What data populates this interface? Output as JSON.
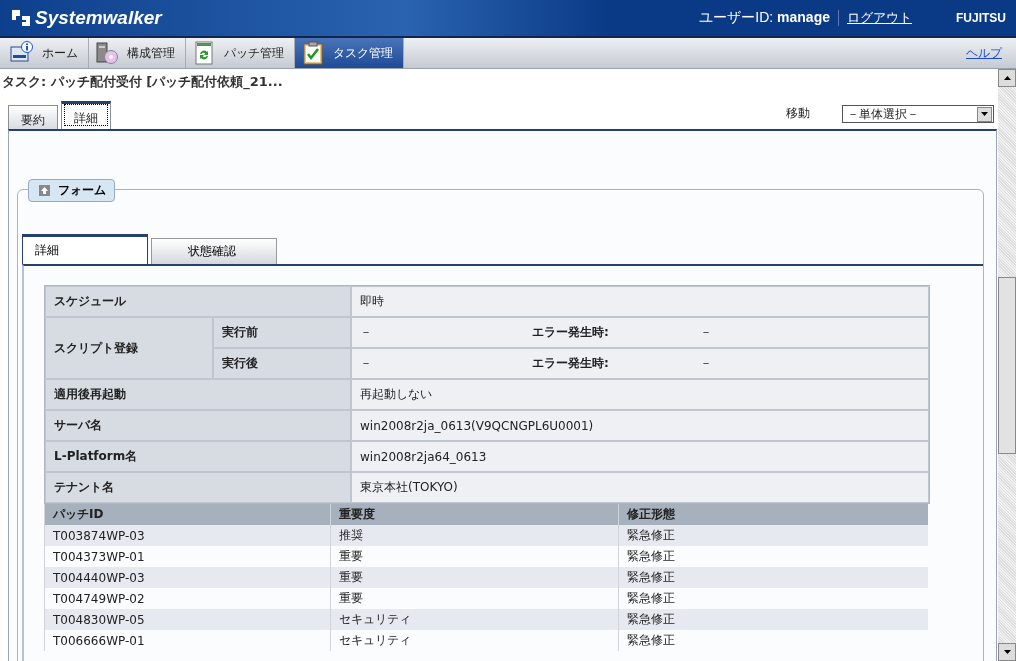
{
  "header": {
    "logo": "Systemwalker",
    "user": "ユーザーID: **manage**",
    "logout": "ログアウト",
    "brand": "FUJITSU"
  },
  "nav": {
    "tabs": [
      {
        "label": "ホーム",
        "kind": "home",
        "selected": false
      },
      {
        "label": "構成管理",
        "kind": "config",
        "selected": false
      },
      {
        "label": "パッチ管理",
        "kind": "patch",
        "selected": false
      },
      {
        "label": "タスク管理",
        "kind": "task",
        "selected": true
      }
    ],
    "help": "ヘルプ"
  },
  "task_title": "タスク: パッチ配付受付 [パッチ配付依頼_21...",
  "tabs": [
    {
      "label": "要約",
      "selected": false
    },
    {
      "label": "詳細",
      "selected": true
    }
  ],
  "move": {
    "label": "移動",
    "value": "－単体選択－"
  },
  "form": {
    "legend": "フォーム",
    "tabs": [
      {
        "label": "詳細",
        "selected": true
      },
      {
        "label": "状態確認",
        "selected": false
      }
    ],
    "details": [
      {
        "kind": "simple",
        "label": "スケジュール",
        "value": "即時"
      },
      {
        "kind": "split",
        "label": "スクリプト登録",
        "subrows": [
          {
            "label": "実行前",
            "value": "－",
            "error_label": "エラー発生時:",
            "error_value": "－"
          },
          {
            "label": "実行後",
            "value": "－",
            "error_label": "エラー発生時:",
            "error_value": "－"
          }
        ]
      },
      {
        "kind": "simple",
        "label": "適用後再起動",
        "value": "再起動しない"
      },
      {
        "kind": "simple",
        "label": "サーバ名",
        "value": "win2008r2ja_0613(V9QCNGPL6U0001)"
      },
      {
        "kind": "simple",
        "label": "L-Platform名",
        "value": "win2008r2ja64_0613"
      },
      {
        "kind": "simple",
        "label": "テナント名",
        "value": "東京本社(TOKYO)"
      }
    ],
    "patches": {
      "columns": [
        "パッチID",
        "重要度",
        "修正形態"
      ],
      "rows": [
        [
          "T003874WP-03",
          "推奨",
          "緊急修正"
        ],
        [
          "T004373WP-01",
          "重要",
          "緊急修正"
        ],
        [
          "T004440WP-03",
          "重要",
          "緊急修正"
        ],
        [
          "T004749WP-02",
          "重要",
          "緊急修正"
        ],
        [
          "T004830WP-05",
          "セキュリティ",
          "緊急修正"
        ],
        [
          "T006666WP-01",
          "セキュリティ",
          "緊急修正"
        ]
      ]
    }
  }
}
